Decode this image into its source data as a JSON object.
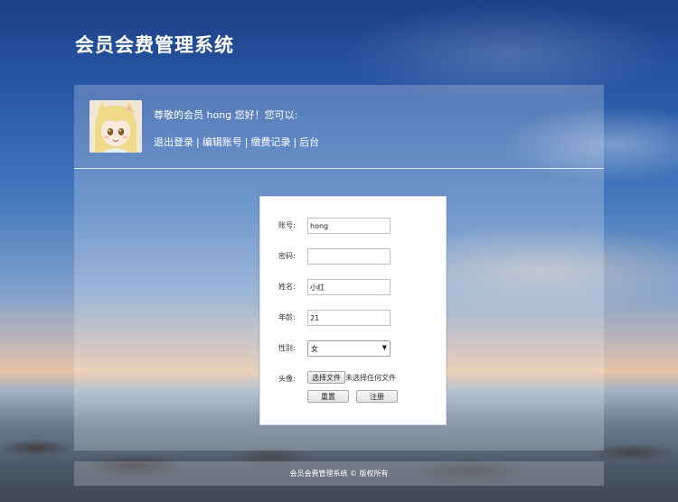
{
  "site": {
    "title": "会员会费管理系统"
  },
  "user": {
    "greeting": "尊敬的会员 hong 您好！您可以:",
    "links": [
      {
        "label": "退出登录"
      },
      {
        "label": "编辑账号"
      },
      {
        "label": "缴费记录"
      },
      {
        "label": "后台"
      }
    ],
    "separator": "|"
  },
  "form": {
    "account": {
      "label": "账号:",
      "value": "hong"
    },
    "password": {
      "label": "密码:",
      "value": ""
    },
    "name": {
      "label": "姓名:",
      "value": "小红"
    },
    "age": {
      "label": "年龄:",
      "value": "21"
    },
    "gender": {
      "label": "性别:",
      "selected": "女"
    },
    "avatar": {
      "label": "头像:",
      "choose_label": "选择文件",
      "status": "未选择任何文件"
    },
    "reset_label": "重置",
    "register_label": "注册"
  },
  "footer": {
    "text": "会员会费管理系统 © 版权所有"
  }
}
